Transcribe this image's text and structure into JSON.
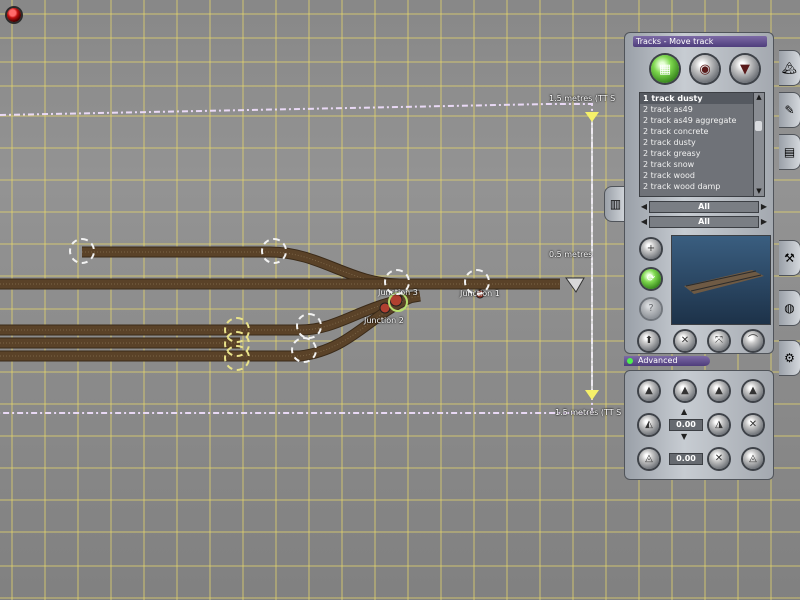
{
  "viewport": {
    "measure_top": "1.5 metres  (TT S",
    "measure_mid": "0.5 metres",
    "measure_bottom": "1.5 metres  (TT S",
    "junctions": [
      "Junction 1",
      "Junction 2",
      "Junction 3"
    ]
  },
  "panel": {
    "title": "Tracks - Move track",
    "tools": [
      {
        "name": "move-track-tool-icon",
        "glyph": "▦"
      },
      {
        "name": "spline-point-tool-icon",
        "glyph": "◉"
      },
      {
        "name": "height-tool-icon",
        "glyph": "▼"
      }
    ],
    "track_list": [
      "1 track dusty",
      "2 track as49",
      "2 track as49 aggregate",
      "2 track concrete",
      "2 track dusty",
      "2 track greasy",
      "2 track snow",
      "2 track wood",
      "2 track wood damp"
    ],
    "selected_index": 0,
    "filter_1": "All",
    "filter_2": "All",
    "advanced_label": "Advanced",
    "value_1": "0.00",
    "value_2": "0.00"
  },
  "colors": {
    "accent": "#7ed84e",
    "title_bar": "#5e4d8d",
    "grid_line": "#e8d86a",
    "track": "#5a4228"
  }
}
